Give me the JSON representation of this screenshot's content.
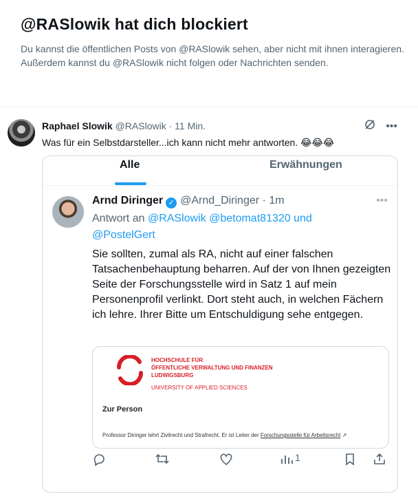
{
  "block_notice": {
    "title": "@RASlowik hat dich blockiert",
    "description": "Du kannst die öffentlichen Posts von @RASlowik sehen, aber nicht mit ihnen interagieren. Außerdem kannst du @RASlowik nicht folgen oder Nachrichten senden."
  },
  "tweet": {
    "author_name": "Raphael Slowik",
    "handle": "@RASlowik",
    "separator": "·",
    "time": "11 Min.",
    "text": "Was für ein Selbstdarsteller...ich kann nicht mehr antworten. 😂😂😂",
    "icons": [
      "grok-icon",
      "more-icon"
    ]
  },
  "embedded": {
    "tabs": [
      "Alle",
      "Erwähnungen"
    ],
    "active_tab": "Alle",
    "reply": {
      "author_name": "Arnd Diringer",
      "handle": "@Arnd_Diringer",
      "separator": "·",
      "time": "1m",
      "reply_to_prefix": "Antwort an",
      "reply_to_handles": [
        "@RASlowik",
        "@betomat81320",
        "und",
        "@PostelGert"
      ],
      "text": "Sie sollten, zumal als RA, nicht auf einer falschen Tatsachenbehauptung beharren. Auf der von Ihnen gezeigten Seite der Forschungsstelle wird in Satz 1 auf mein Personenprofil verlinkt. Dort steht auch, in welchen Fächern ich lehre. Ihrer Bitte um Entschuldigung sehe entgegen.",
      "card": {
        "org_lines": [
          "HOCHSCHULE FÜR",
          "ÖFFENTLICHE VERWALTUNG UND FINANZEN",
          "LUDWIGSBURG"
        ],
        "org_subtitle": "UNIVERSITY OF APPLIED SCIENCES",
        "section_title": "Zur Person",
        "description_prefix": "Professor Diringer lehrt Zivilrecht und Strafrecht. Er ist Leiter der ",
        "description_link": "Forschungsstelle für Arbeitsrecht",
        "link_arrow": "↗"
      },
      "views": "1"
    }
  },
  "colors": {
    "accent": "#1d9bf0",
    "text_primary": "#0f1419",
    "text_secondary": "#536471",
    "border": "#cfd9de",
    "hs_red": "#d61f26"
  }
}
